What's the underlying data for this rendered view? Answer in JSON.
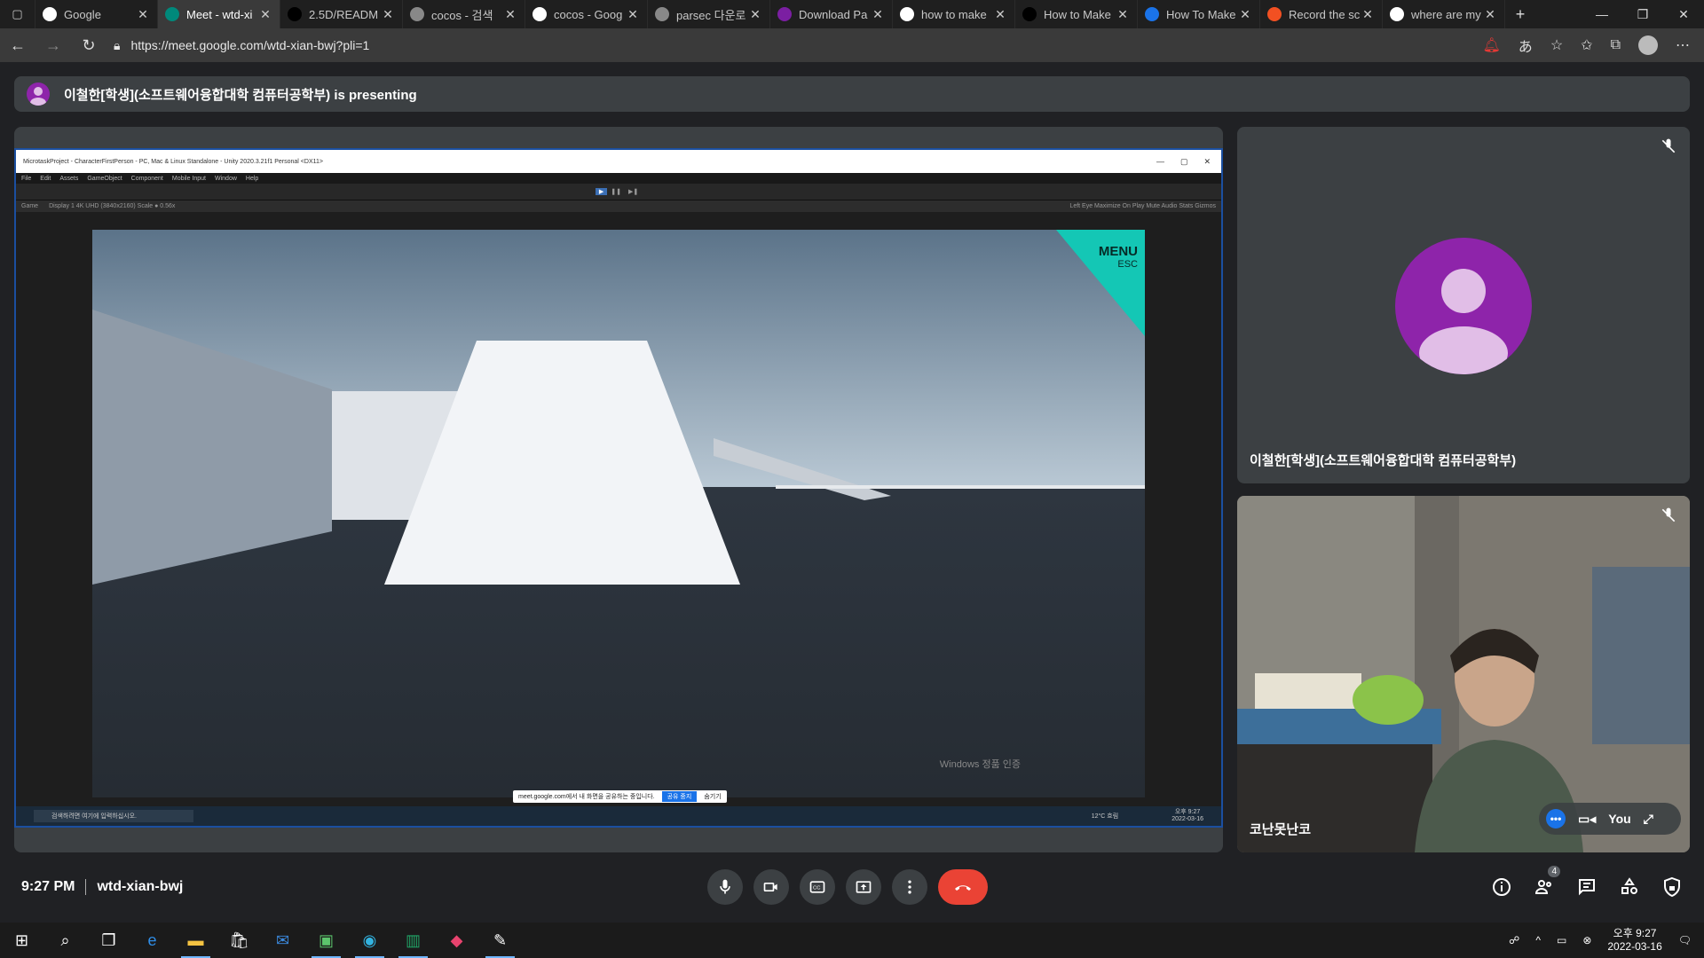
{
  "browser": {
    "tabs": [
      {
        "label": "Google",
        "icon": "google-icon"
      },
      {
        "label": "Meet - wtd-xi",
        "icon": "meet-icon",
        "active": true
      },
      {
        "label": "2.5D/READM",
        "icon": "github-icon"
      },
      {
        "label": "cocos - 검색",
        "icon": "search-icon"
      },
      {
        "label": "cocos - Goog",
        "icon": "google-icon"
      },
      {
        "label": "parsec 다운로",
        "icon": "search-icon"
      },
      {
        "label": "Download Pa",
        "icon": "parsec-icon"
      },
      {
        "label": "how to make",
        "icon": "google-icon"
      },
      {
        "label": "How to Make",
        "icon": "unity-icon"
      },
      {
        "label": "How To Make",
        "icon": "doc-icon"
      },
      {
        "label": "Record the sc",
        "icon": "microsoft-icon"
      },
      {
        "label": "where are my",
        "icon": "google-icon"
      }
    ],
    "url": "https://meet.google.com/wtd-xian-bwj?pli=1"
  },
  "banner": {
    "text": "이철한[학생](소프트웨어융합대학 컴퓨터공학부) is presenting"
  },
  "presentation": {
    "unity_title": "MicrotaskProject - CharacterFirstPerson - PC, Mac & Linux Standalone - Unity 2020.3.21f1 Personal <DX11>",
    "unity_menu": [
      "File",
      "Edit",
      "Assets",
      "GameObject",
      "Component",
      "Mobile Input",
      "Window",
      "Help"
    ],
    "game_tab": "Game",
    "display": "Display 1   4K UHD (3840x2160)   Scale ● 0.56x",
    "game_options": "Left Eye   Maximize On Play   Mute Audio   Stats   Gizmos",
    "menu_label": "MENU",
    "menu_sub": "ESC",
    "share_notice": "meet.google.com에서 내 화면을 공유하는 중입니다.",
    "share_stop": "공유 중지",
    "share_hide": "숨기기",
    "search_placeholder": "검색하려면 여기에 입력하십시오.",
    "weather": "12°C 흐림",
    "mini_time": "오후 9:27",
    "mini_date": "2022-03-16",
    "windows_watermark": "Windows 정품 인증"
  },
  "participants": [
    {
      "name": "이철한[학생](소프트웨어융합대학 컴퓨터공학부)"
    },
    {
      "name": "코난못난코",
      "self_label": "You"
    }
  ],
  "meeting": {
    "time": "9:27 PM",
    "code": "wtd-xian-bwj",
    "participant_count": "4"
  },
  "taskbar": {
    "time": "오후 9:27",
    "date": "2022-03-16"
  }
}
